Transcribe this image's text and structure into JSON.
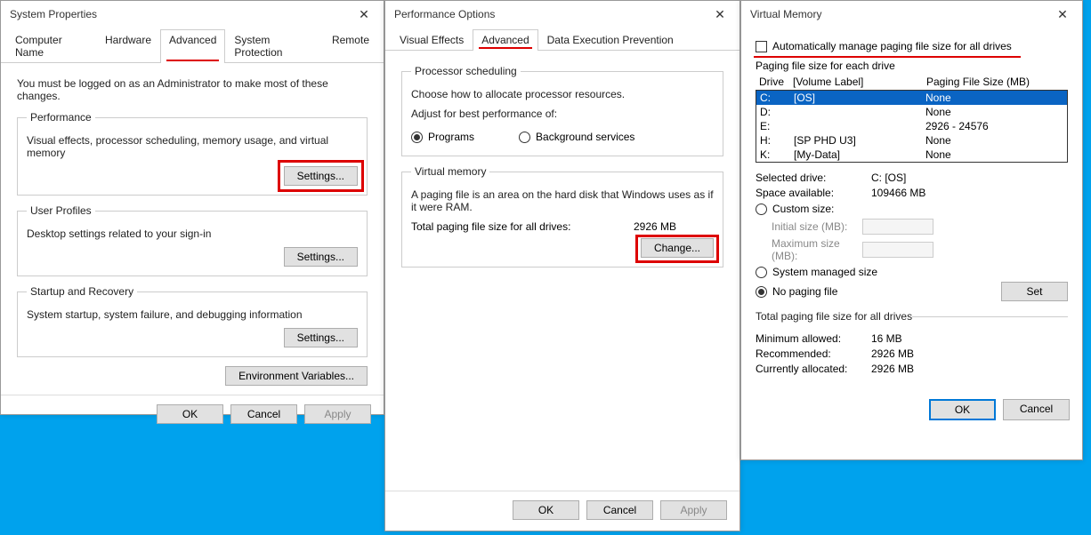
{
  "dialog1": {
    "title": "System Properties",
    "tabs": [
      "Computer Name",
      "Hardware",
      "Advanced",
      "System Protection",
      "Remote"
    ],
    "activeTab": 2,
    "adminNote": "You must be logged on as an Administrator to make most of these changes.",
    "perf": {
      "legend": "Performance",
      "desc": "Visual effects, processor scheduling, memory usage, and virtual memory",
      "btn": "Settings..."
    },
    "profiles": {
      "legend": "User Profiles",
      "desc": "Desktop settings related to your sign-in",
      "btn": "Settings..."
    },
    "startup": {
      "legend": "Startup and Recovery",
      "desc": "System startup, system failure, and debugging information",
      "btn": "Settings..."
    },
    "envBtn": "Environment Variables...",
    "ok": "OK",
    "cancel": "Cancel",
    "apply": "Apply"
  },
  "dialog2": {
    "title": "Performance Options",
    "tabs": [
      "Visual Effects",
      "Advanced",
      "Data Execution Prevention"
    ],
    "activeTab": 1,
    "sched": {
      "legend": "Processor scheduling",
      "desc": "Choose how to allocate processor resources.",
      "adjust": "Adjust for best performance of:",
      "programs": "Programs",
      "bg": "Background services"
    },
    "vm": {
      "legend": "Virtual memory",
      "desc": "A paging file is an area on the hard disk that Windows uses as if it were RAM.",
      "totalLabel": "Total paging file size for all drives:",
      "totalValue": "2926 MB",
      "change": "Change..."
    },
    "ok": "OK",
    "cancel": "Cancel",
    "apply": "Apply"
  },
  "dialog3": {
    "title": "Virtual Memory",
    "autoManage": "Automatically manage paging file size for all drives",
    "listHeader": {
      "title": "Paging file size for each drive",
      "col1": "Drive",
      "col2": "[Volume Label]",
      "col3": "Paging File Size (MB)"
    },
    "drives": [
      {
        "letter": "C:",
        "label": "[OS]",
        "size": "None",
        "selected": true
      },
      {
        "letter": "D:",
        "label": "",
        "size": "None",
        "selected": false
      },
      {
        "letter": "E:",
        "label": "",
        "size": "2926 - 24576",
        "selected": false
      },
      {
        "letter": "H:",
        "label": "[SP PHD U3]",
        "size": "None",
        "selected": false
      },
      {
        "letter": "K:",
        "label": "[My-Data]",
        "size": "None",
        "selected": false
      }
    ],
    "selectedDriveLabel": "Selected drive:",
    "selectedDriveValue": "C:  [OS]",
    "spaceLabel": "Space available:",
    "spaceValue": "109466 MB",
    "custom": "Custom size:",
    "initial": "Initial size (MB):",
    "max": "Maximum size (MB):",
    "sysManaged": "System managed size",
    "noPaging": "No paging file",
    "set": "Set",
    "totals": {
      "legend": "Total paging file size for all drives",
      "min": "Minimum allowed:",
      "minV": "16 MB",
      "rec": "Recommended:",
      "recV": "2926 MB",
      "cur": "Currently allocated:",
      "curV": "2926 MB"
    },
    "ok": "OK",
    "cancel": "Cancel"
  }
}
